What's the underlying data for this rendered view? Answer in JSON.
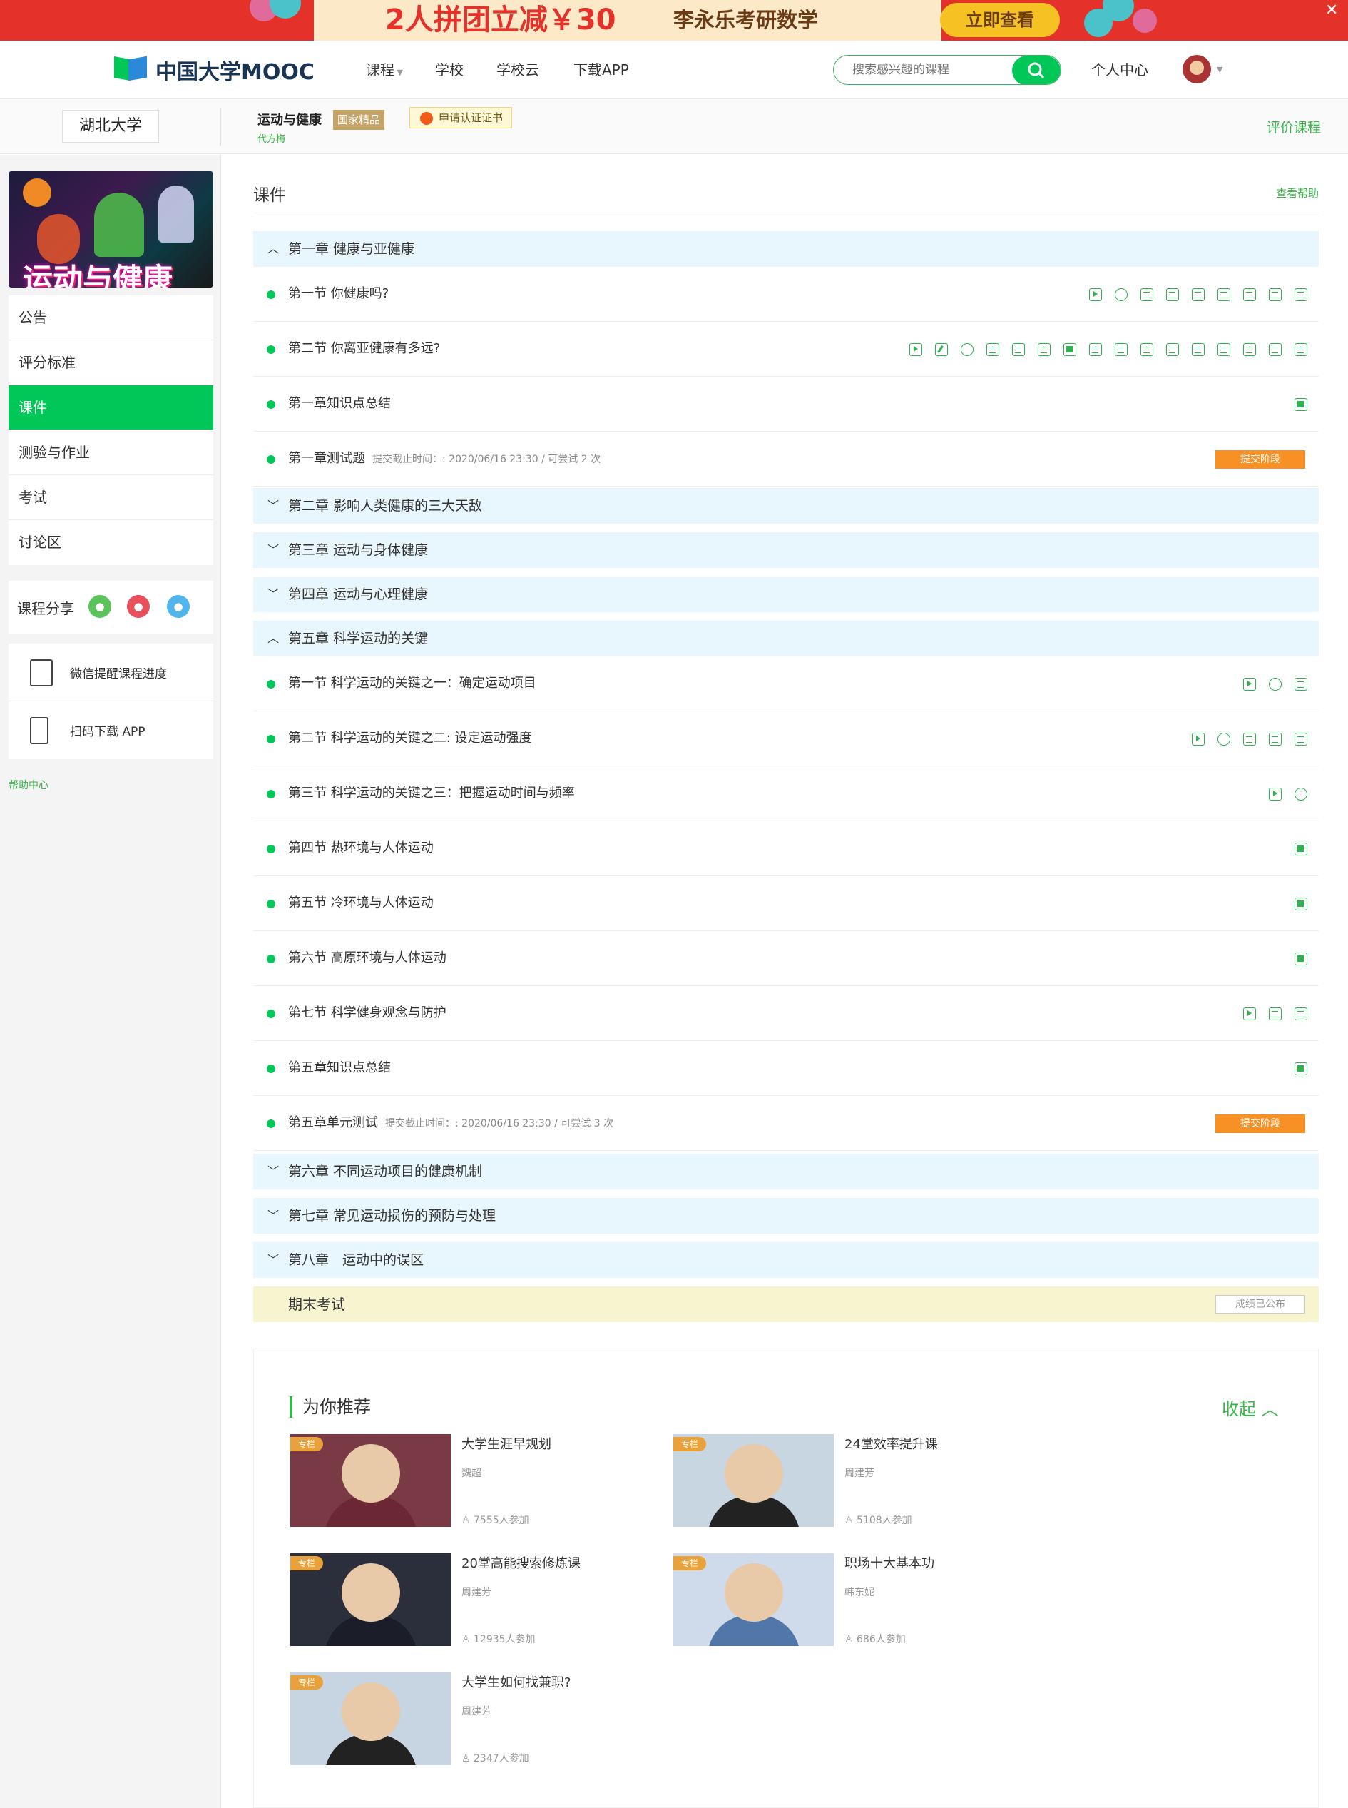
{
  "banner": {
    "text": "2人拼团立减￥30",
    "product": "李永乐考研数学",
    "button": "立即查看",
    "close": "✕"
  },
  "nav": {
    "logo": "中国大学MOOC",
    "items": [
      "课程",
      "学校",
      "学校云",
      "下载APP"
    ],
    "search_placeholder": "搜索感兴趣的课程",
    "personal": "个人中心"
  },
  "course": {
    "school": "湖北大学",
    "name": "运动与健康",
    "badge": "国家精品",
    "teacher": "代方梅",
    "cert": "申请认证证书",
    "rate": "评价课程"
  },
  "sidebar": {
    "banner_text": "运动与健康",
    "items": [
      {
        "label": "公告"
      },
      {
        "label": "评分标准"
      },
      {
        "label": "课件",
        "active": true
      },
      {
        "label": "测验与作业"
      },
      {
        "label": "考试"
      },
      {
        "label": "讨论区"
      }
    ],
    "share": "课程分享",
    "wechat_reminder": "微信提醒课程进度",
    "download_app": "扫码下载 APP",
    "help": "帮助中心"
  },
  "main": {
    "title": "课件",
    "help": "查看帮助",
    "chapters": [
      {
        "title": "第一章 健康与亚健康",
        "open": true
      },
      {
        "title": "第二章 影响人类健康的三大天敌",
        "open": false
      },
      {
        "title": "第三章 运动与身体健康",
        "open": false
      },
      {
        "title": "第四章 运动与心理健康",
        "open": false
      },
      {
        "title": "第五章 科学运动的关键",
        "open": true
      },
      {
        "title": "第六章 不同运动项目的健康机制",
        "open": false
      },
      {
        "title": "第七章 常见运动损伤的预防与处理",
        "open": false
      },
      {
        "title": "第八章　运动中的误区",
        "open": false
      }
    ],
    "ch1_rows": [
      {
        "title": "第一节 你健康吗?",
        "icons": [
          "v",
          "c",
          "d",
          "d",
          "d",
          "d",
          "d",
          "d",
          "d"
        ]
      },
      {
        "title": "第二节 你离亚健康有多远?",
        "icons": [
          "v",
          "e",
          "c",
          "d",
          "d",
          "d",
          "n",
          "d",
          "d",
          "d",
          "d",
          "d",
          "d",
          "d",
          "d",
          "d"
        ]
      },
      {
        "title": "第一章知识点总结",
        "icons": [
          "n"
        ]
      },
      {
        "title": "第一章测试题",
        "deadline": "提交截止时间：: 2020/06/16 23:30 / 可尝试 2 次",
        "button": "提交阶段"
      }
    ],
    "ch5_rows": [
      {
        "title": "第一节 科学运动的关键之一：确定运动项目",
        "icons": [
          "v",
          "c",
          "d"
        ]
      },
      {
        "title": "第二节 科学运动的关键之二: 设定运动强度",
        "icons": [
          "v",
          "c",
          "d",
          "d",
          "d"
        ]
      },
      {
        "title": "第三节 科学运动的关键之三：把握运动时间与频率",
        "icons": [
          "v",
          "c"
        ]
      },
      {
        "title": "第四节 热环境与人体运动",
        "icons": [
          "n"
        ]
      },
      {
        "title": "第五节 冷环境与人体运动",
        "icons": [
          "n"
        ]
      },
      {
        "title": "第六节 高原环境与人体运动",
        "icons": [
          "n"
        ]
      },
      {
        "title": "第七节 科学健身观念与防护",
        "icons": [
          "v",
          "d",
          "d"
        ]
      },
      {
        "title": "第五章知识点总结",
        "icons": [
          "n"
        ]
      },
      {
        "title": "第五章单元测试",
        "deadline": "提交截止时间：: 2020/06/16 23:30 / 可尝试 3 次",
        "button": "提交阶段"
      }
    ],
    "final": {
      "title": "期末考试",
      "status": "成绩已公布"
    }
  },
  "reco": {
    "title": "为你推荐",
    "collapse": "收起",
    "tag": "专栏",
    "cards": [
      {
        "title": "大学生涯早规划",
        "author": "魏超",
        "count": "7555人参加",
        "bg": "#7a3a45",
        "body": "#6b2733"
      },
      {
        "title": "24堂效率提升课",
        "author": "周建芳",
        "count": "5108人参加",
        "bg": "#c8d6e2",
        "body": "#222"
      },
      {
        "title": "20堂高能搜索修炼课",
        "author": "周建芳",
        "count": "12935人参加",
        "bg": "#2b2f3c",
        "body": "#1b1e28"
      },
      {
        "title": "职场十大基本功",
        "author": "韩东妮",
        "count": "686人参加",
        "bg": "#cfdaea",
        "body": "#5077a8"
      },
      {
        "title": "大学生如何找兼职?",
        "author": "周建芳",
        "count": "2347人参加",
        "bg": "#c7d5e3",
        "body": "#222"
      }
    ]
  }
}
